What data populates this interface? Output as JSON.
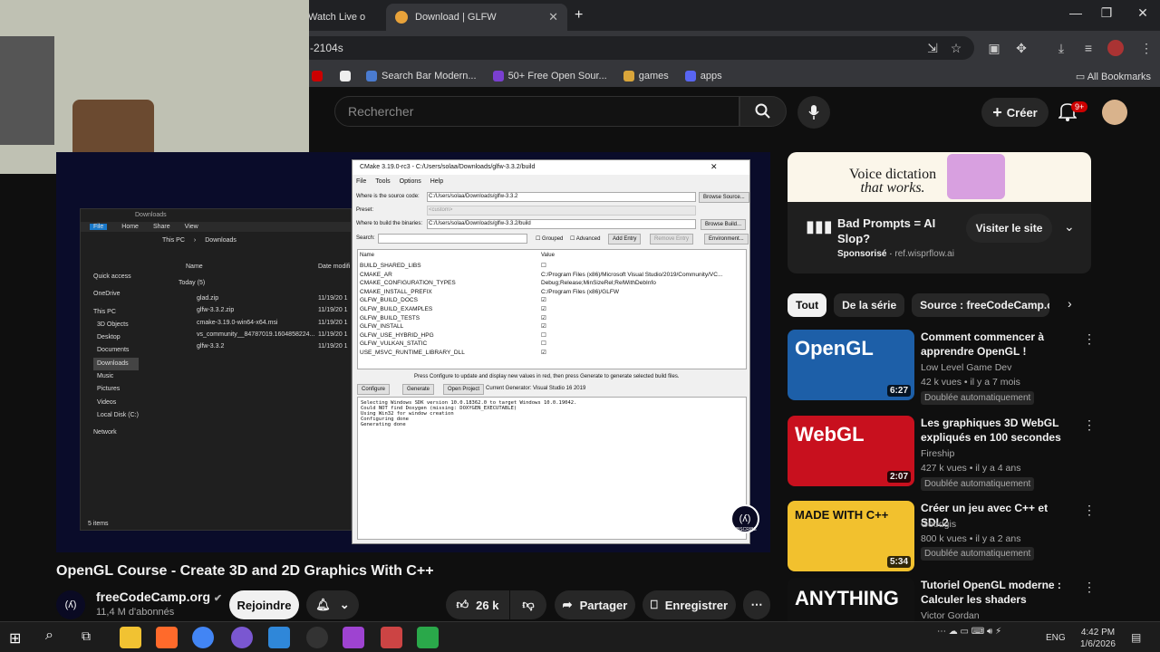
{
  "browser": {
    "tabs": [
      {
        "label": "Watch Live o"
      },
      {
        "label": "Download | GLFW"
      }
    ],
    "address": "-2104s",
    "bookmarks": [
      "Search Bar Modern...",
      "50+ Free Open Sour...",
      "games",
      "apps"
    ],
    "all_bookmarks": "All Bookmarks"
  },
  "youtube": {
    "search_placeholder": "Rechercher",
    "create_label": "Créer",
    "notif_count": "9+"
  },
  "video": {
    "title": "OpenGL Course - Create 3D and 2D Graphics With C++",
    "channel": "freeCodeCamp.org",
    "subscribers": "11,4 M d'abonnés",
    "join_label": "Rejoindre",
    "likes": "26 k",
    "share_label": "Partager",
    "save_label": "Enregistrer"
  },
  "screen": {
    "explorer": {
      "path": "Downloads",
      "menu": [
        "File",
        "Home",
        "Share",
        "View"
      ],
      "crumb": [
        "This PC",
        "Downloads"
      ],
      "nav": [
        "Quick access",
        "OneDrive",
        "This PC",
        "3D Objects",
        "Desktop",
        "Documents",
        "Downloads",
        "Music",
        "Pictures",
        "Videos",
        "Local Disk (C:)",
        "Network"
      ],
      "col_name": "Name",
      "col_date": "Date modifi",
      "group": "Today (5)",
      "files": [
        "glad.zip",
        "glfw-3.3.2.zip",
        "cmake-3.19.0-win64-x64.msi",
        "vs_community__84787019.1604858224...",
        "glfw-3.3.2"
      ],
      "file_date": "11/19/20 1",
      "status": "5 items"
    },
    "cmake": {
      "title": "CMake 3.19.0-rc3 - C:/Users/solaa/Downloads/glfw-3.3.2/build",
      "menu": [
        "File",
        "Tools",
        "Options",
        "Help"
      ],
      "source_label": "Where is the source code:",
      "source": "C:/Users/solaa/Downloads/glfw-3.3.2",
      "source_btn": "Browse Source...",
      "preset_label": "Preset:",
      "preset": "<custom>",
      "build_label": "Where to build the binaries:",
      "build": "C:/Users/solaa/Downloads/glfw-3.3.2/build",
      "build_btn": "Browse Build...",
      "search_label": "Search:",
      "grouped": "Grouped",
      "advanced": "Advanced",
      "add_entry": "Add Entry",
      "remove_entry": "Remove Entry",
      "environment": "Environment...",
      "col_name": "Name",
      "col_value": "Value",
      "entries": [
        {
          "name": "BUILD_SHARED_LIBS",
          "value": "",
          "check": false
        },
        {
          "name": "CMAKE_AR",
          "value": "C:/Program Files (x86)/Microsoft Visual Studio/2019/Community/VC...",
          "check": null
        },
        {
          "name": "CMAKE_CONFIGURATION_TYPES",
          "value": "Debug;Release;MinSizeRel;RelWithDebInfo",
          "check": null
        },
        {
          "name": "CMAKE_INSTALL_PREFIX",
          "value": "C:/Program Files (x86)/GLFW",
          "check": null
        },
        {
          "name": "GLFW_BUILD_DOCS",
          "value": "",
          "check": true
        },
        {
          "name": "GLFW_BUILD_EXAMPLES",
          "value": "",
          "check": true
        },
        {
          "name": "GLFW_BUILD_TESTS",
          "value": "",
          "check": true
        },
        {
          "name": "GLFW_INSTALL",
          "value": "",
          "check": true
        },
        {
          "name": "GLFW_USE_HYBRID_HPG",
          "value": "",
          "check": false
        },
        {
          "name": "GLFW_VULKAN_STATIC",
          "value": "",
          "check": false
        },
        {
          "name": "USE_MSVC_RUNTIME_LIBRARY_DLL",
          "value": "",
          "check": true
        }
      ],
      "hint": "Press Configure to update and display new values in red, then press Generate to generate selected build files.",
      "configure": "Configure",
      "generate": "Generate",
      "open_project": "Open Project",
      "generator": "Current Generator: Visual Studio 16 2019",
      "output": [
        "Selecting Windows SDK version 10.0.18362.0 to target Windows 10.0.19042.",
        "Could NOT find Doxygen (missing: DOXYGEN_EXECUTABLE)",
        "Using Win32 for window creation",
        "Configuring done",
        "Generating done"
      ]
    },
    "subscribe": "SUBSCRIBE"
  },
  "ad": {
    "image_text": "Voice dictation",
    "image_text2": "that works.",
    "title": "Bad Prompts = AI Slop?",
    "sponsored": "Sponsorisé",
    "domain": "ref.wisprflow.ai",
    "cta": "Visiter le site"
  },
  "chips": [
    "Tout",
    "De la série",
    "Source : freeCodeCamp.org"
  ],
  "recommendations": [
    {
      "title": "Comment commencer à apprendre OpenGL !",
      "channel": "Low Level Game Dev",
      "meta": "42 k vues • il y a 7 mois",
      "duration": "6:27",
      "dub": "Doublée automatiquement",
      "thumb_text": "OpenGL",
      "color": "#1d5fa8"
    },
    {
      "title": "Les graphiques 3D WebGL expliqués en 100 secondes",
      "channel": "Fireship",
      "meta": "427 k vues • il y a 4 ans",
      "duration": "2:07",
      "dub": "Doublée automatiquement",
      "thumb_text": "WebGL",
      "color": "#c8101e"
    },
    {
      "title": "Créer un jeu avec C++ et SDL2",
      "channel": "Goodgis",
      "meta": "800 k vues • il y a 2 ans",
      "duration": "5:34",
      "dub": "Doublée automatiquement",
      "thumb_text": "MADE WITH C++",
      "color": "#f2c12e"
    },
    {
      "title": "Tutoriel OpenGL moderne : Calculer les shaders",
      "channel": "Victor Gordan",
      "meta": "",
      "duration": "",
      "dub": "",
      "thumb_text": "ANYTHING",
      "color": "#111"
    }
  ],
  "taskbar": {
    "lang": "ENG",
    "time": "4:42 PM",
    "date": "1/6/2026"
  }
}
